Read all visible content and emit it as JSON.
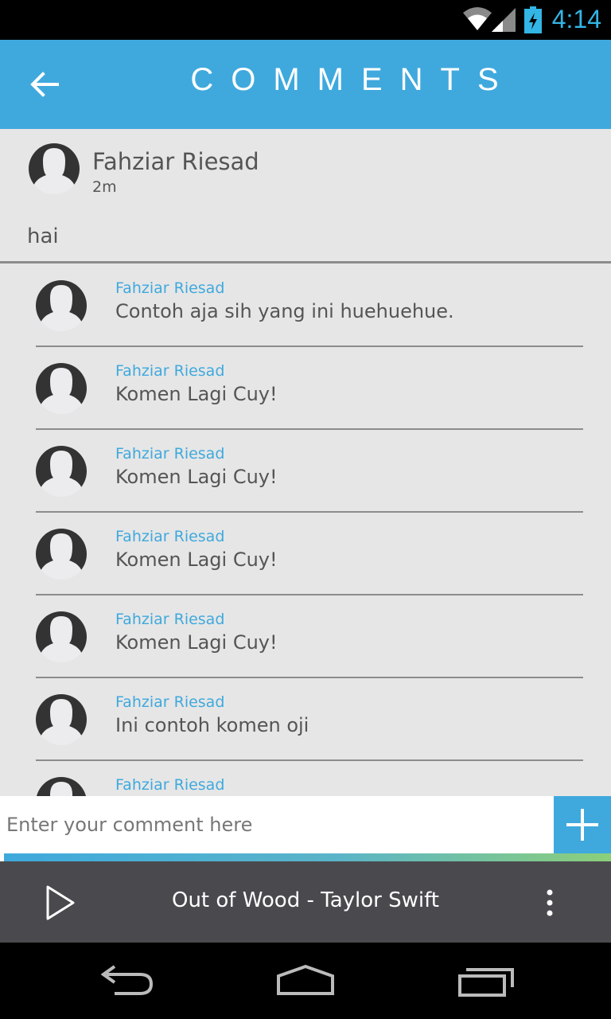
{
  "status_bar": {
    "time": "4:14"
  },
  "app_bar": {
    "title": "COMMENTS"
  },
  "post": {
    "author": "Fahziar Riesad",
    "time": "2m",
    "text": "hai"
  },
  "comments": [
    {
      "author": "Fahziar Riesad",
      "text": "Contoh aja sih yang ini huehuehue."
    },
    {
      "author": "Fahziar Riesad",
      "text": "Komen Lagi Cuy!"
    },
    {
      "author": "Fahziar Riesad",
      "text": "Komen Lagi Cuy!"
    },
    {
      "author": "Fahziar Riesad",
      "text": "Komen Lagi Cuy!"
    },
    {
      "author": "Fahziar Riesad",
      "text": "Komen Lagi Cuy!"
    },
    {
      "author": "Fahziar Riesad",
      "text": "Ini contoh komen oji"
    },
    {
      "author": "Fahziar Riesad",
      "text": ""
    }
  ],
  "comment_input": {
    "placeholder": "Enter your comment here",
    "value": ""
  },
  "player": {
    "track": "Out of Wood - Taylor Swift",
    "progress": 0.0
  },
  "colors": {
    "accent": "#3fa9dd",
    "player_bg": "#4a4a4e",
    "content_bg": "#e6e6e6"
  },
  "icons": [
    "back-arrow-icon",
    "wifi-icon",
    "signal-icon",
    "battery-icon",
    "plus-icon",
    "play-icon",
    "overflow-menu-icon",
    "nav-back-icon",
    "nav-home-icon",
    "nav-recents-icon"
  ]
}
